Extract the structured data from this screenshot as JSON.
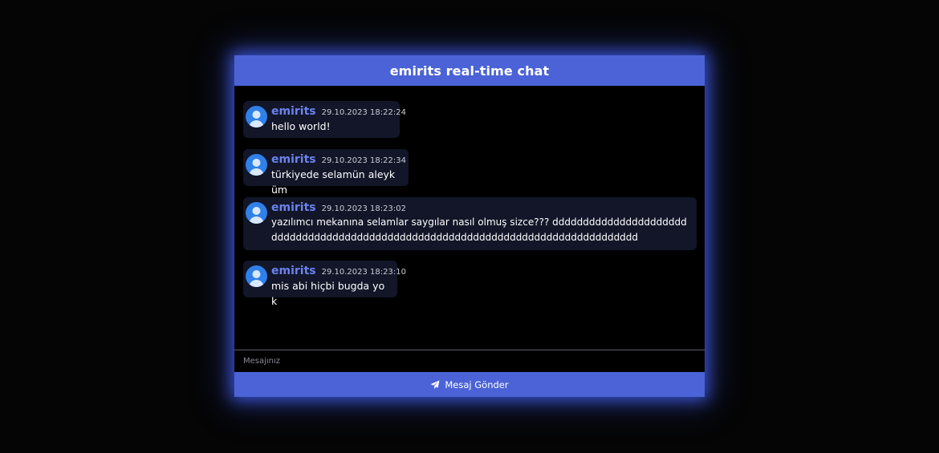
{
  "header": {
    "title": "emirits real-time chat"
  },
  "messages": [
    {
      "username": "emirits",
      "timestamp": "29.10.2023 18:22:24",
      "text": "hello world!"
    },
    {
      "username": "emirits",
      "timestamp": "29.10.2023 18:22:34",
      "text": "türkiyede selamün aleyküm"
    },
    {
      "username": "emirits",
      "timestamp": "29.10.2023 18:23:02",
      "text": "yazılımcı mekanına selamlar saygılar nasıl olmuş sizce??? dddddddddddddddddddddddddddddddddddddddddddddddddddddddddddddddddddddddddddddddddd"
    },
    {
      "username": "emirits",
      "timestamp": "29.10.2023 18:23:10",
      "text": "mis abi hiçbi bugda yok"
    }
  ],
  "input": {
    "placeholder": "Mesajınız",
    "value": ""
  },
  "send": {
    "label": "Mesaj Gönder",
    "icon": "paper-plane-icon"
  },
  "colors": {
    "accent": "#4b63d6",
    "username": "#6b82f0",
    "bubble": "#121628",
    "avatar": "#2f80e8"
  }
}
